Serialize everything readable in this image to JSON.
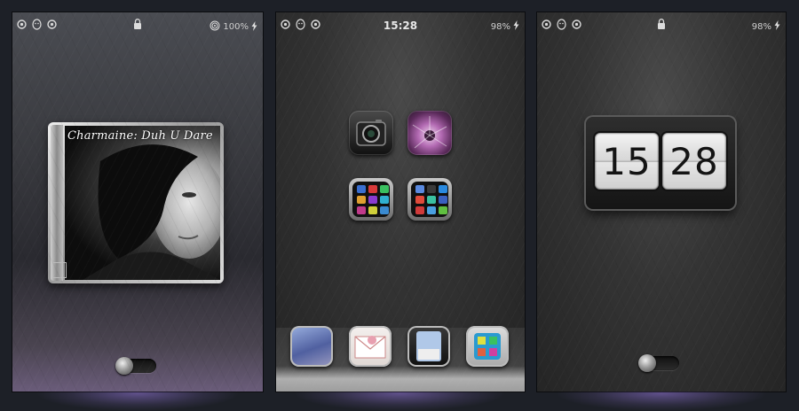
{
  "screens": [
    {
      "status": {
        "battery": "100%"
      },
      "album": {
        "title": "Charmaine: Duh U Dare"
      }
    },
    {
      "status": {
        "time": "15:28",
        "battery": "98%"
      }
    },
    {
      "status": {
        "battery": "98%"
      },
      "clock": {
        "hours": "15",
        "minutes": "28"
      }
    }
  ],
  "colors": {
    "background": "#1d2027",
    "glow": "#9678dc"
  }
}
